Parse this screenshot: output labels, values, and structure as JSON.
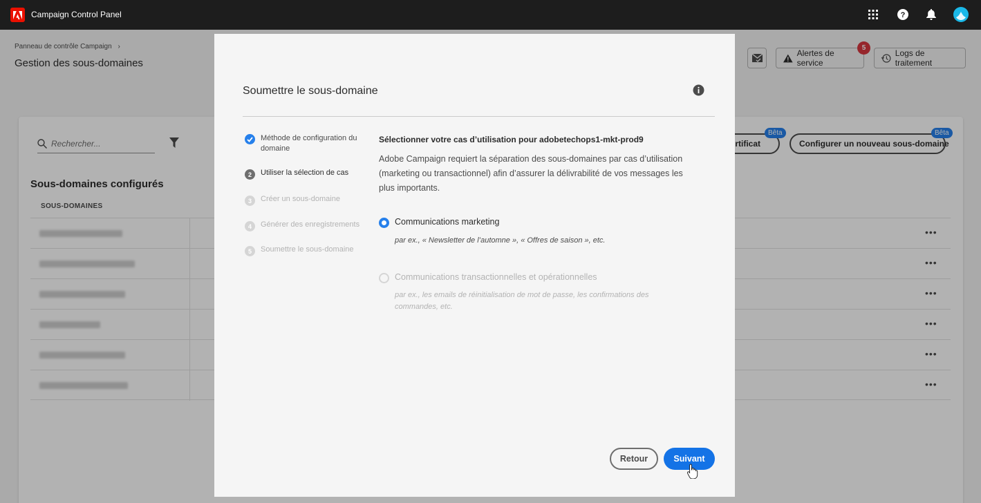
{
  "topbar": {
    "app_title": "Campaign Control Panel"
  },
  "header": {
    "breadcrumb": "Panneau de contrôle Campaign",
    "page_title": "Gestion des sous-domaines",
    "service_alerts_label": "Alertes de service",
    "service_alerts_count": "5",
    "logs_label": "Logs de traitement"
  },
  "list": {
    "search_placeholder": "Rechercher...",
    "section_title": "Sous-domaines configurés",
    "column_subdomains": "SOUS-DOMAINES",
    "certificate_button_label": "e certificat",
    "new_subdomain_button_label": "Configurer un nouveau sous-domaine",
    "beta_label": "Bêta",
    "row_count": 6
  },
  "modal": {
    "title": "Soumettre le sous-domaine",
    "steps": [
      {
        "number": "1",
        "label": "Méthode de configuration du domaine",
        "state": "done"
      },
      {
        "number": "2",
        "label": "Utiliser la sélection de cas",
        "state": "current"
      },
      {
        "number": "3",
        "label": "Créer un sous-domaine",
        "state": "todo"
      },
      {
        "number": "4",
        "label": "Générer des enregistrements",
        "state": "todo"
      },
      {
        "number": "5",
        "label": "Soumettre le sous-domaine",
        "state": "todo"
      }
    ],
    "content_title": "Sélectionner votre cas d’utilisation pour adobetechops1-mkt-prod9",
    "content_desc": "Adobe Campaign requiert la séparation des sous-domaines par cas d’utilisation (marketing ou transactionnel) afin d’assurer la délivrabilité de vos messages les plus importants.",
    "options": [
      {
        "label": "Communications marketing",
        "hint": "par ex., « Newsletter de l’automne », « Offres de saison », etc.",
        "selected": true
      },
      {
        "label": "Communications transactionnelles et opérationnelles",
        "hint": "par ex., les emails de réinitialisation de mot de passe, les confirmations des commandes, etc.",
        "selected": false
      }
    ],
    "back_label": "Retour",
    "next_label": "Suivant"
  },
  "colors": {
    "accent": "#1473e6",
    "step_done": "#2680eb",
    "alert_badge": "#d7373f",
    "topbar": "#1d1d1d"
  }
}
